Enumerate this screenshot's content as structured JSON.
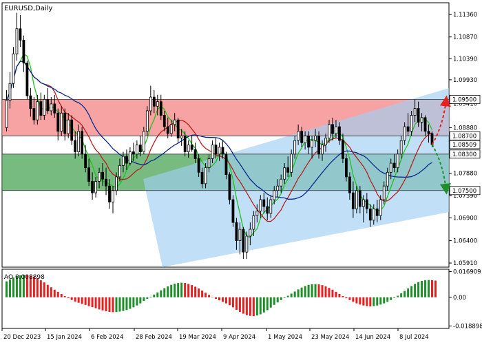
{
  "chart_data": {
    "type": "candlestick",
    "title": "EURUSD,Daily",
    "x_tick_labels": [
      "20 Dec 2023",
      "15 Jan 2024",
      "6 Feb 2024",
      "28 Feb 2024",
      "19 Mar 2024",
      "9 Apr 2024",
      "1 May 2024",
      "23 May 2024",
      "14 Jun 2024",
      "8 Jul 2024"
    ],
    "price_axis": {
      "ylim": [
        1.0582,
        1.1162
      ],
      "ticks": [
        "1.11360",
        "1.10870",
        "1.10390",
        "1.09930",
        "1.09410",
        "1.08880",
        "1.07880",
        "1.07390",
        "1.06900",
        "1.06400",
        "1.05910"
      ]
    },
    "levels": [
      {
        "value": 1.095,
        "label": "1.09500"
      },
      {
        "value": 1.087,
        "label": "1.08700"
      },
      {
        "value": 1.083,
        "label": "1.08300"
      },
      {
        "value": 1.075,
        "label": "1.07500"
      }
    ],
    "last_price": {
      "value": 1.08509,
      "label": "1.08509"
    },
    "zones": [
      {
        "name": "resistance",
        "from": 1.087,
        "to": 1.095,
        "color": "#f47c7c"
      },
      {
        "name": "support",
        "from": 1.075,
        "to": 1.083,
        "color": "#3f9e4a"
      }
    ],
    "channel_color": "#9fd0f2",
    "moving_average_colors": [
      "#1fc21f",
      "#b51f1f",
      "#0b2a8f"
    ],
    "forecast_arrows": [
      {
        "direction": "up",
        "target": 1.095,
        "color": "#e52020"
      },
      {
        "direction": "down",
        "target": 1.075,
        "color": "#1f8f2a"
      }
    ],
    "oscillator": {
      "label": "AO 0.008898",
      "ticks": [
        "0.016909",
        "0.00",
        "-0.018898"
      ],
      "ylim": [
        -0.0205,
        0.0185
      ],
      "up_color": "#1f8f2a",
      "down_color": "#e52020"
    },
    "ohlc": [
      [
        1.0888,
        1.097,
        1.088,
        1.0948
      ],
      [
        1.0948,
        1.101,
        1.093,
        1.0985
      ],
      [
        1.0985,
        1.1065,
        1.0975,
        1.105
      ],
      [
        1.105,
        1.114,
        1.1035,
        1.1105
      ],
      [
        1.1105,
        1.1135,
        1.1065,
        1.108
      ],
      [
        1.108,
        1.109,
        1.101,
        1.103
      ],
      [
        1.103,
        1.1035,
        1.095,
        1.0958
      ],
      [
        1.0958,
        1.0975,
        1.0912,
        1.093
      ],
      [
        1.093,
        1.0955,
        1.0895,
        1.0905
      ],
      [
        1.0905,
        1.096,
        1.0895,
        1.0945
      ],
      [
        1.0945,
        1.0965,
        1.0905,
        1.0915
      ],
      [
        1.0915,
        1.096,
        1.0905,
        1.095
      ],
      [
        1.095,
        1.0975,
        1.0918,
        1.0925
      ],
      [
        1.0925,
        1.0955,
        1.0915,
        1.094
      ],
      [
        1.094,
        1.096,
        1.091,
        1.092
      ],
      [
        1.092,
        1.093,
        1.086,
        1.088
      ],
      [
        1.088,
        1.0935,
        1.087,
        1.092
      ],
      [
        1.092,
        1.093,
        1.086,
        1.0875
      ],
      [
        1.0875,
        1.092,
        1.0865,
        1.0905
      ],
      [
        1.0905,
        1.0915,
        1.085,
        1.086
      ],
      [
        1.086,
        1.088,
        1.082,
        1.0835
      ],
      [
        1.0835,
        1.0895,
        1.0825,
        1.088
      ],
      [
        1.088,
        1.089,
        1.082,
        1.083
      ],
      [
        1.083,
        1.085,
        1.079,
        1.08
      ],
      [
        1.08,
        1.082,
        1.076,
        1.077
      ],
      [
        1.077,
        1.079,
        1.073,
        1.0745
      ],
      [
        1.0745,
        1.078,
        1.0735,
        1.077
      ],
      [
        1.077,
        1.08,
        1.0755,
        1.079
      ],
      [
        1.079,
        1.081,
        1.076,
        1.0775
      ],
      [
        1.0775,
        1.08,
        1.074,
        1.076
      ],
      [
        1.076,
        1.0775,
        1.071,
        1.0725
      ],
      [
        1.0725,
        1.076,
        1.07,
        1.075
      ],
      [
        1.075,
        1.079,
        1.074,
        1.078
      ],
      [
        1.078,
        1.082,
        1.077,
        1.0805
      ],
      [
        1.0805,
        1.0835,
        1.079,
        1.0825
      ],
      [
        1.0825,
        1.084,
        1.0795,
        1.081
      ],
      [
        1.081,
        1.0845,
        1.0805,
        1.0835
      ],
      [
        1.0835,
        1.0855,
        1.0815,
        1.083
      ],
      [
        1.083,
        1.086,
        1.082,
        1.085
      ],
      [
        1.085,
        1.087,
        1.0825,
        1.0835
      ],
      [
        1.0835,
        1.089,
        1.083,
        1.088
      ],
      [
        1.088,
        1.0935,
        1.087,
        1.0925
      ],
      [
        1.0925,
        1.098,
        1.0915,
        1.0955
      ],
      [
        1.0955,
        1.097,
        1.092,
        1.0935
      ],
      [
        1.0935,
        1.096,
        1.0915,
        1.0945
      ],
      [
        1.0945,
        1.096,
        1.0905,
        1.0915
      ],
      [
        1.0915,
        1.0925,
        1.088,
        1.089
      ],
      [
        1.089,
        1.091,
        1.0865,
        1.0875
      ],
      [
        1.0875,
        1.0905,
        1.0868,
        1.0895
      ],
      [
        1.0895,
        1.092,
        1.088,
        1.0905
      ],
      [
        1.0905,
        1.091,
        1.0855,
        1.0865
      ],
      [
        1.0865,
        1.0885,
        1.0848,
        1.087
      ],
      [
        1.087,
        1.088,
        1.0825,
        1.0835
      ],
      [
        1.0835,
        1.086,
        1.0822,
        1.085
      ],
      [
        1.085,
        1.087,
        1.0835,
        1.084
      ],
      [
        1.084,
        1.0855,
        1.081,
        1.082
      ],
      [
        1.082,
        1.083,
        1.078,
        1.079
      ],
      [
        1.079,
        1.08,
        1.0755,
        1.0765
      ],
      [
        1.0765,
        1.081,
        1.0755,
        1.08
      ],
      [
        1.08,
        1.083,
        1.079,
        1.082
      ],
      [
        1.082,
        1.086,
        1.081,
        1.085
      ],
      [
        1.085,
        1.0865,
        1.082,
        1.083
      ],
      [
        1.083,
        1.0855,
        1.0815,
        1.0845
      ],
      [
        1.0845,
        1.086,
        1.082,
        1.083
      ],
      [
        1.083,
        1.0835,
        1.0775,
        1.0785
      ],
      [
        1.0785,
        1.079,
        1.072,
        1.073
      ],
      [
        1.073,
        1.074,
        1.067,
        1.068
      ],
      [
        1.068,
        1.069,
        1.062,
        1.064
      ],
      [
        1.064,
        1.068,
        1.061,
        1.0665
      ],
      [
        1.0665,
        1.067,
        1.06,
        1.0615
      ],
      [
        1.0615,
        1.066,
        1.06,
        1.065
      ],
      [
        1.065,
        1.068,
        1.063,
        1.0665
      ],
      [
        1.0665,
        1.0705,
        1.065,
        1.0695
      ],
      [
        1.0695,
        1.072,
        1.068,
        1.0705
      ],
      [
        1.0705,
        1.074,
        1.069,
        1.073
      ],
      [
        1.073,
        1.0745,
        1.07,
        1.0715
      ],
      [
        1.0715,
        1.0735,
        1.0685,
        1.07
      ],
      [
        1.07,
        1.074,
        1.069,
        1.073
      ],
      [
        1.073,
        1.076,
        1.072,
        1.075
      ],
      [
        1.075,
        1.0775,
        1.0735,
        1.076
      ],
      [
        1.076,
        1.0785,
        1.0745,
        1.0775
      ],
      [
        1.0775,
        1.081,
        1.0765,
        1.08
      ],
      [
        1.08,
        1.0825,
        1.078,
        1.079
      ],
      [
        1.079,
        1.084,
        1.078,
        1.083
      ],
      [
        1.083,
        1.087,
        1.082,
        1.086
      ],
      [
        1.086,
        1.0895,
        1.085,
        1.088
      ],
      [
        1.088,
        1.089,
        1.0845,
        1.0855
      ],
      [
        1.0855,
        1.088,
        1.084,
        1.087
      ],
      [
        1.087,
        1.088,
        1.083,
        1.0845
      ],
      [
        1.0845,
        1.087,
        1.082,
        1.086
      ],
      [
        1.086,
        1.0885,
        1.0845,
        1.087
      ],
      [
        1.087,
        1.088,
        1.082,
        1.083
      ],
      [
        1.083,
        1.086,
        1.0815,
        1.085
      ],
      [
        1.085,
        1.0875,
        1.0835,
        1.0865
      ],
      [
        1.0865,
        1.0905,
        1.0855,
        1.0895
      ],
      [
        1.0895,
        1.091,
        1.086,
        1.0875
      ],
      [
        1.0875,
        1.0905,
        1.0865,
        1.089
      ],
      [
        1.089,
        1.09,
        1.085,
        1.086
      ],
      [
        1.086,
        1.0875,
        1.081,
        1.082
      ],
      [
        1.082,
        1.083,
        1.077,
        1.078
      ],
      [
        1.078,
        1.079,
        1.073,
        1.0745
      ],
      [
        1.0745,
        1.077,
        1.069,
        1.071
      ],
      [
        1.071,
        1.076,
        1.07,
        1.075
      ],
      [
        1.075,
        1.076,
        1.07,
        1.0715
      ],
      [
        1.0715,
        1.074,
        1.068,
        1.073
      ],
      [
        1.073,
        1.0745,
        1.07,
        1.071
      ],
      [
        1.071,
        1.072,
        1.067,
        1.0685
      ],
      [
        1.0685,
        1.072,
        1.0675,
        1.071
      ],
      [
        1.071,
        1.073,
        1.068,
        1.0695
      ],
      [
        1.0695,
        1.074,
        1.0685,
        1.073
      ],
      [
        1.073,
        1.077,
        1.072,
        1.076
      ],
      [
        1.076,
        1.08,
        1.075,
        1.079
      ],
      [
        1.079,
        1.082,
        1.0775,
        1.081
      ],
      [
        1.081,
        1.083,
        1.079,
        1.08
      ],
      [
        1.08,
        1.084,
        1.079,
        1.083
      ],
      [
        1.083,
        1.087,
        1.082,
        1.086
      ],
      [
        1.086,
        1.09,
        1.085,
        1.089
      ],
      [
        1.089,
        1.092,
        1.087,
        1.088
      ],
      [
        1.088,
        1.0925,
        1.087,
        1.0915
      ],
      [
        1.0915,
        1.095,
        1.09,
        1.093
      ],
      [
        1.093,
        1.0945,
        1.089,
        1.09
      ],
      [
        1.09,
        1.092,
        1.088,
        1.091
      ],
      [
        1.091,
        1.0915,
        1.087,
        1.088
      ],
      [
        1.088,
        1.0895,
        1.0855,
        1.0875
      ],
      [
        1.0875,
        1.088,
        1.0845,
        1.0851
      ]
    ],
    "ao_values": [
      0.0105,
      0.0118,
      0.013,
      0.014,
      0.0145,
      0.0148,
      0.0146,
      0.0142,
      0.0135,
      0.0125,
      0.0112,
      0.0098,
      0.0082,
      0.0066,
      0.005,
      0.0036,
      0.0022,
      0.0008,
      -0.0006,
      -0.0018,
      -0.0028,
      -0.0036,
      -0.0043,
      -0.005,
      -0.0058,
      -0.0065,
      -0.0072,
      -0.008,
      -0.0086,
      -0.0092,
      -0.0096,
      -0.0098,
      -0.0097,
      -0.0094,
      -0.009,
      -0.0084,
      -0.0076,
      -0.0066,
      -0.0054,
      -0.004,
      -0.0024,
      -0.001,
      0.0004,
      0.0018,
      0.0032,
      0.0046,
      0.006,
      0.0072,
      0.0082,
      0.009,
      0.0094,
      0.0096,
      0.0094,
      0.0088,
      0.008,
      0.007,
      0.0058,
      0.0044,
      0.003,
      0.0016,
      0.0002,
      -0.001,
      -0.002,
      -0.003,
      -0.004,
      -0.0052,
      -0.0066,
      -0.0082,
      -0.0096,
      -0.0108,
      -0.0118,
      -0.0122,
      -0.0124,
      -0.012,
      -0.0112,
      -0.01,
      -0.0085,
      -0.0068,
      -0.005,
      -0.0034,
      -0.0018,
      -0.0004,
      0.001,
      0.0024,
      0.0038,
      0.0052,
      0.0064,
      0.0074,
      0.0082,
      0.0086,
      0.0087,
      0.0085,
      0.008,
      0.0072,
      0.0062,
      0.005,
      0.0036,
      0.0022,
      0.0008,
      -0.0006,
      -0.0018,
      -0.003,
      -0.004,
      -0.0048,
      -0.0054,
      -0.0058,
      -0.006,
      -0.0058,
      -0.0054,
      -0.0048,
      -0.004,
      -0.003,
      -0.0018,
      -0.0004,
      0.001,
      0.0026,
      0.0042,
      0.0058,
      0.0074,
      0.0088,
      0.01,
      0.0108,
      0.0112,
      0.0114,
      0.0113,
      0.011
    ]
  }
}
